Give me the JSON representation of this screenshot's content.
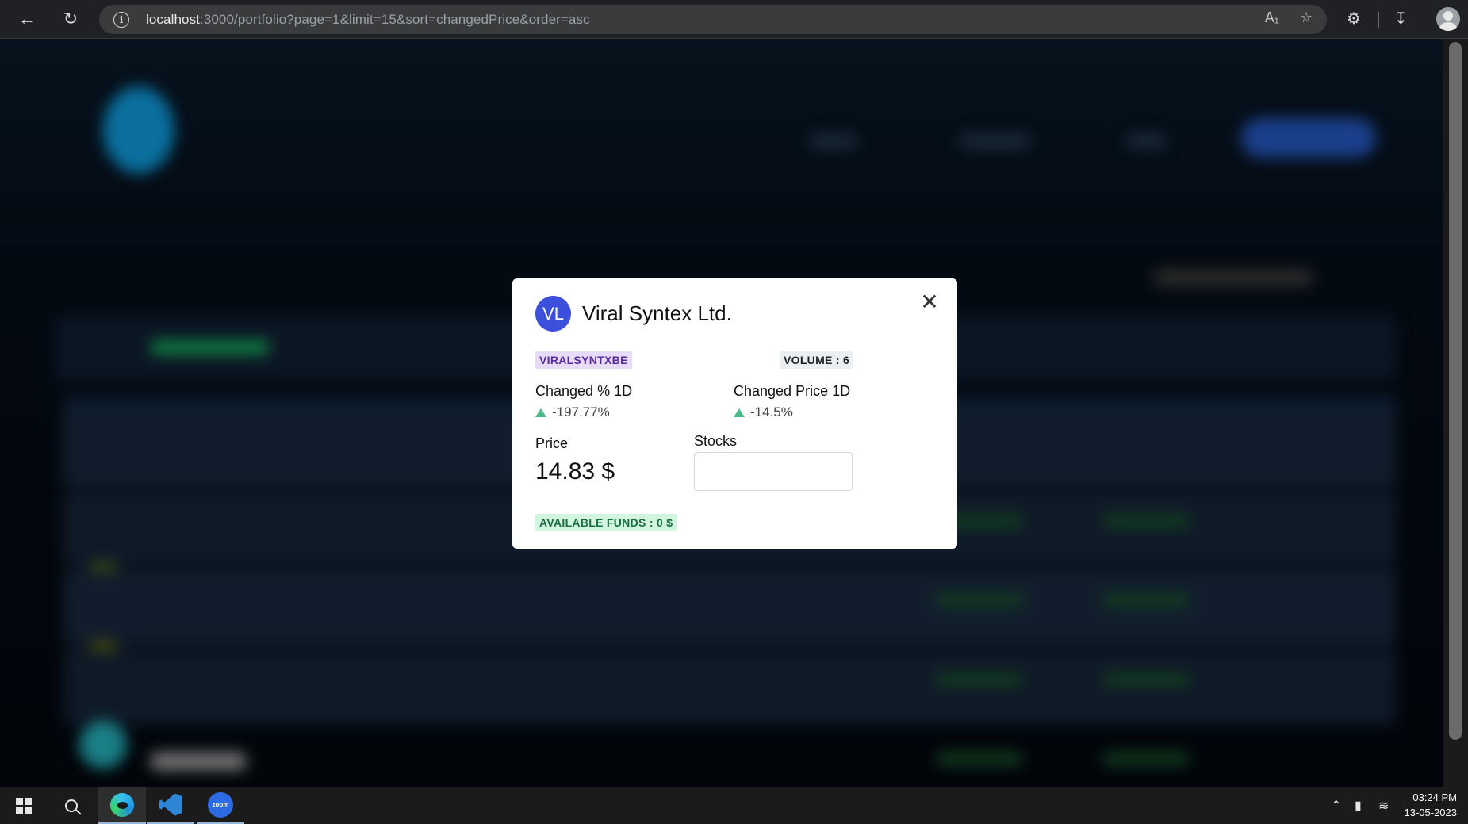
{
  "browser": {
    "url_host": "localhost",
    "url_rest": ":3000/portfolio?page=1&limit=15&sort=changedPrice&order=asc"
  },
  "modal": {
    "avatar_initials": "VL",
    "company_name": "Viral Syntex Ltd.",
    "symbol": "VIRALSYNTXBE",
    "volume": "VOLUME : 6",
    "changed_pct_label": "Changed % 1D",
    "changed_pct_value": "-197.77%",
    "changed_price_label": "Changed Price 1D",
    "changed_price_value": "-14.5%",
    "price_label": "Price",
    "price_value": "14.83 $",
    "stocks_label": "Stocks",
    "stocks_value": "",
    "available_funds": "AVAILABLE FUNDS : 0 $",
    "close_glyph": "✕",
    "colors": {
      "avatar_bg": "#3b4fdc",
      "up_arrow": "#4cb98a",
      "symbol_tag_bg": "#e6dcf7",
      "funds_tag_bg": "#d2f5e0"
    }
  },
  "taskbar": {
    "zoom_label": "zoom",
    "time": "03:24 PM",
    "date": "13-05-2023"
  }
}
